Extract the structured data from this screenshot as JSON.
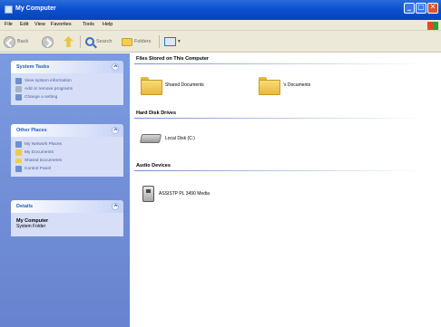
{
  "window": {
    "title": "My Computer",
    "controls": {
      "minimize": "_",
      "maximize": "□",
      "close": "✕"
    }
  },
  "menu": [
    "File",
    "Edit",
    "View",
    "Favorites",
    "Tools",
    "Help"
  ],
  "toolbar": {
    "back": "Back",
    "search": "Search",
    "folders": "Folders"
  },
  "sidebar": {
    "system_tasks": {
      "title": "System Tasks",
      "items": [
        "View system information",
        "Add or remove programs",
        "Change a setting"
      ]
    },
    "other_places": {
      "title": "Other Places",
      "items": [
        "My Network Places",
        "My Documents",
        "Shared Documents",
        "Control Panel"
      ]
    },
    "details": {
      "title": "Details",
      "name": "My Computer",
      "subtitle": "System Folder"
    }
  },
  "main": {
    "groups": [
      {
        "title": "Files Stored on This Computer",
        "items": [
          {
            "label": "Shared Documents",
            "icon": "folder-icon"
          },
          {
            "label": "'s Documents",
            "icon": "folder-icon"
          }
        ]
      },
      {
        "title": "Hard Disk Drives",
        "items": [
          {
            "label": "Local Disk (C:)",
            "icon": "hard-drive-icon"
          }
        ]
      },
      {
        "title": "Audio Devices",
        "items": [
          {
            "label": "ASSISTP PL 3490 Media",
            "icon": "audio-player-icon"
          }
        ]
      }
    ]
  },
  "colors": {
    "titlebar": "#0a4fd0",
    "sidebar_bg": "#6e8bd6",
    "panel_body": "#d6dff7",
    "panel_title": "#215dc6"
  }
}
